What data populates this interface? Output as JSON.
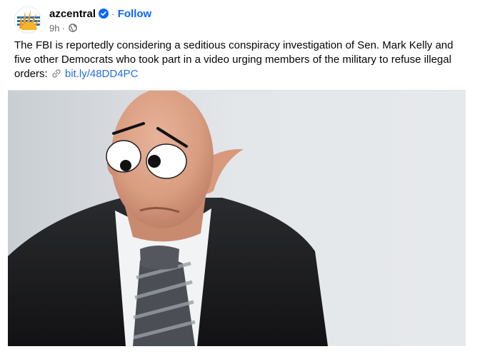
{
  "post": {
    "page_name": "azcentral",
    "separator": "·",
    "follow_label": "Follow",
    "time": "9h",
    "time_separator": "·",
    "caption_text": "The FBI is reportedly considering a seditious conspiracy investigation of Sen. Mark Kelly and five other Democrats who took part in a video urging members of the military to refuse illegal orders:",
    "link_text": "bit.ly/48DD4PC"
  },
  "colors": {
    "accent": "#0866ff",
    "secondary_text": "#65676b",
    "link": "#216fdb",
    "sky": "#e2e6ea"
  },
  "icons": {
    "avatar": "azcentral-sun-logo",
    "verified": "verified-badge-icon",
    "audience": "globe-icon",
    "link": "link-icon"
  }
}
